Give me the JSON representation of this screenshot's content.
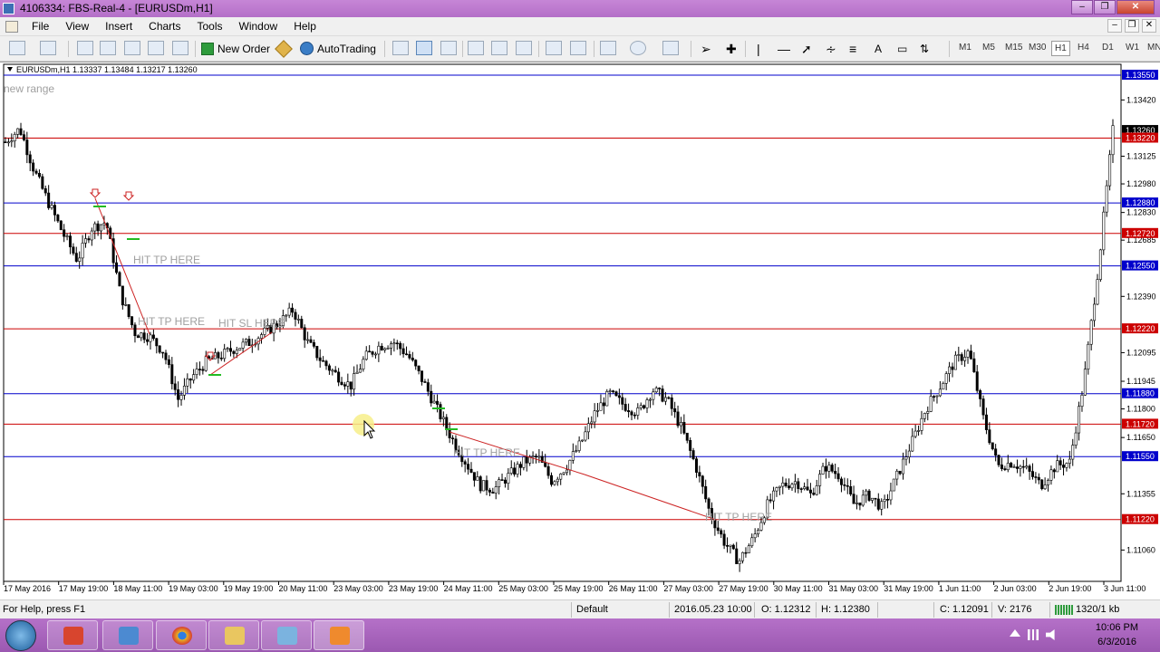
{
  "titlebar": {
    "title": "4106334: FBS-Real-4 - [EURUSDm,H1]"
  },
  "menu": {
    "items": [
      "File",
      "View",
      "Insert",
      "Charts",
      "Tools",
      "Window",
      "Help"
    ]
  },
  "toolbar": {
    "new_order": "New Order",
    "autotrading": "AutoTrading",
    "timeframes": [
      "M1",
      "M5",
      "M15",
      "M30",
      "H1",
      "H4",
      "D1",
      "W1",
      "MN"
    ],
    "active_timeframe": "H1"
  },
  "chart": {
    "symbol_info": "EURUSDm,H1  1.13337 1.13484 1.13217 1.13260",
    "price_labels": [
      "1.13420",
      "1.13125",
      "1.12980",
      "1.12830",
      "1.12685",
      "1.12390",
      "1.12095",
      "1.11945",
      "1.11800",
      "1.11650",
      "1.11355",
      "1.11060"
    ],
    "highlighted_levels": [
      {
        "label": "1.13550",
        "color": "#0000cc"
      },
      {
        "label": "1.13260",
        "color": "#000000"
      },
      {
        "label": "1.13220",
        "color": "#cc0000"
      },
      {
        "label": "1.12880",
        "color": "#0000cc"
      },
      {
        "label": "1.12720",
        "color": "#cc0000"
      },
      {
        "label": "1.12550",
        "color": "#0000cc"
      },
      {
        "label": "1.12220",
        "color": "#cc0000"
      },
      {
        "label": "1.11880",
        "color": "#0000cc"
      },
      {
        "label": "1.11720",
        "color": "#cc0000"
      },
      {
        "label": "1.11550",
        "color": "#0000cc"
      },
      {
        "label": "1.11220",
        "color": "#cc0000"
      }
    ],
    "time_labels": [
      "17 May 2016",
      "17 May 19:00",
      "18 May 11:00",
      "19 May 03:00",
      "19 May 19:00",
      "20 May 11:00",
      "23 May 03:00",
      "23 May 19:00",
      "24 May 11:00",
      "25 May 03:00",
      "25 May 19:00",
      "26 May 11:00",
      "27 May 03:00",
      "27 May 19:00",
      "30 May 11:00",
      "31 May 03:00",
      "31 May 19:00",
      "1 Jun 11:00",
      "2 Jun 03:00",
      "2 Jun 19:00",
      "3 Jun 11:00"
    ],
    "annotations": {
      "new_range": "new range",
      "tp1": "HIT TP HERE",
      "tp2": "HIT TP HERE",
      "sl": "HIT SL HERE",
      "tp3": "HIT TP HERE",
      "tp4": "HIT TP HERE"
    }
  },
  "statusbar": {
    "help": "For Help, press F1",
    "profile": "Default",
    "datetime": "2016.05.23 10:00",
    "open": "O: 1.12312",
    "high": "H: 1.12380",
    "close": "C: 1.12091",
    "volume": "V: 2176",
    "traffic": "1320/1 kb"
  },
  "taskbar": {
    "time": "10:06 PM",
    "date": "6/3/2016"
  },
  "colors": {
    "accent": "#b46fc8",
    "level_red": "#cc0000",
    "level_blue": "#0000cc"
  }
}
